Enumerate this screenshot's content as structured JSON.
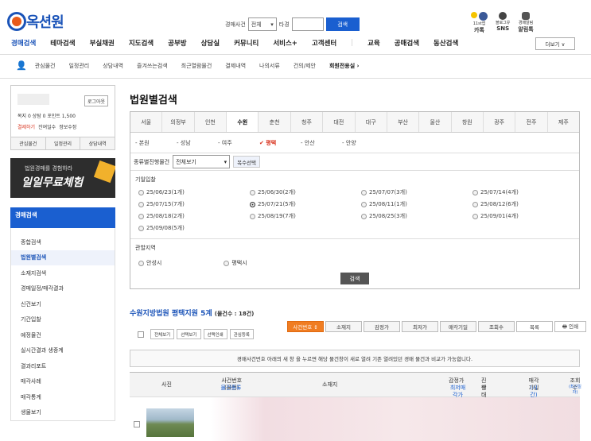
{
  "header": {
    "logo": "옥션원",
    "search_label": "경매사건",
    "year": "전체",
    "ta": "타경",
    "search_btn": "검색",
    "icons": [
      {
        "top": "11st앱",
        "bottom": "카톡"
      },
      {
        "top": "블로그유",
        "bottom": "SNS"
      },
      {
        "top": "경매알림",
        "bottom": "알림톡"
      }
    ]
  },
  "main_nav": [
    "경매검색",
    "테마검색",
    "부실채권",
    "지도검색",
    "공부방",
    "상담실",
    "커뮤니티",
    "서비스+",
    "고객센터",
    "교육",
    "공매검색",
    "동산검색"
  ],
  "more_btn": "더보기 ∨",
  "sub_nav": [
    "관심물건",
    "일정관리",
    "상담내역",
    "즐겨쓰는검색",
    "최근열람물건",
    "결제내역",
    "나의서류",
    "건의/제안",
    "회원전용실 ›"
  ],
  "user": {
    "logout": "로그아웃",
    "points": "목지 0  상탐 0  포인트 1,500",
    "pay": "결제하기",
    "days": "잔여일수",
    "info": "정보수정",
    "tabs": [
      "관심물건",
      "일정관리",
      "상담내역"
    ]
  },
  "banner": {
    "line1": "법원경매를 경험하라",
    "line2": "일일무료체험"
  },
  "left_menu": {
    "header": "경매검색",
    "items": [
      "종합검색",
      "법원별검색",
      "소재지검색",
      "경매일정/매각결과",
      "신건보기",
      "기간입찰",
      "예정물건",
      "실시간결과 생중계",
      "결과리포트",
      "매각사례",
      "매각통계",
      "생물보기"
    ],
    "active": 1
  },
  "page_title": "법원별검색",
  "courts": [
    "서울",
    "의정부",
    "인천",
    "수원",
    "춘천",
    "청주",
    "대전",
    "대구",
    "부산",
    "울산",
    "창원",
    "광주",
    "전주",
    "제주"
  ],
  "active_court": 3,
  "sub_courts": [
    "- 본원",
    "- 성남",
    "- 여주",
    "✔ 평택",
    "- 안산",
    "- 안양"
  ],
  "active_sub": 3,
  "filter": {
    "label": "종류별진행물건",
    "value": "전체보기",
    "multi": "복수선택"
  },
  "date_section": {
    "label": "기일입찰",
    "dates": [
      {
        "t": "25/06/23(1개)",
        "red": true
      },
      {
        "t": "25/06/30(2개)",
        "red": true
      },
      {
        "t": "25/07/07(3개)",
        "red": true
      },
      {
        "t": "25/07/14(4개)",
        "red": true
      },
      {
        "t": "25/07/15(7개)",
        "red": true
      },
      {
        "t": "25/07/21(5개)",
        "on": true
      },
      {
        "t": "25/08/11(1개)"
      },
      {
        "t": "25/08/12(6개)"
      },
      {
        "t": "25/08/18(2개)"
      },
      {
        "t": "25/08/19(7개)"
      },
      {
        "t": "25/08/25(3개)"
      },
      {
        "t": "25/09/01(4개)"
      },
      {
        "t": "25/09/08(5개)"
      }
    ]
  },
  "area_section": {
    "label": "관할지역",
    "items": [
      "안성시",
      "평택시"
    ],
    "search": "검색"
  },
  "result": {
    "title": "수원지방법원 평택지원 5계",
    "count": "(물건수 : 18건)"
  },
  "sort_buttons": [
    "사건번호 ↕",
    "소재지",
    "감정가",
    "최저가",
    "매각기일",
    "조회수",
    "목록",
    "🖶 인쇄"
  ],
  "small_buttons": [
    "전체보기",
    "선택보기",
    "선택인쇄",
    "관심등록"
  ],
  "notice": "경매사건번호 아래의  새 창  을 누르면 해당 물건창이 새로 열려 기존 열려있던 경매 물건과 비교가 가능합니다.",
  "table_head": {
    "photo": "사진",
    "case": "사건번호(물번)",
    "kind": "물건종류",
    "addr": "소재지",
    "price": "감정가",
    "min": "최저매각가",
    "prog": "진행",
    "state": "상태",
    "date": "매각기일",
    "time": "(시간)",
    "views": "조회수",
    "views2": "(최근일자)"
  }
}
